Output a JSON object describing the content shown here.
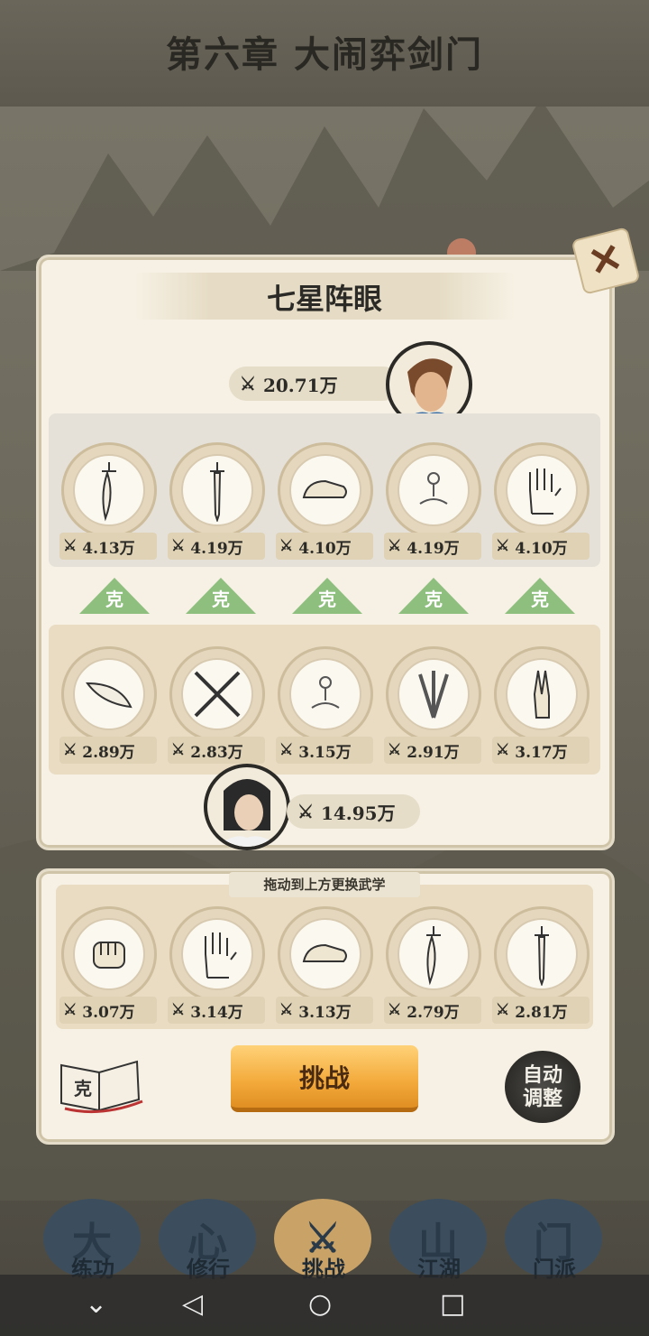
{
  "chapter_title": "第六章 大闹弈剑门",
  "formation": {
    "title": "七星阵眼",
    "enemy_power": "20.71万",
    "player_power": "14.95万",
    "enemy_slots": [
      {
        "icon": "sabre-icon",
        "value": "4.13万"
      },
      {
        "icon": "sword-icon",
        "value": "4.19万"
      },
      {
        "icon": "shoe-icon",
        "value": "4.10万"
      },
      {
        "icon": "meditation-icon",
        "value": "4.19万"
      },
      {
        "icon": "palm-icon",
        "value": "4.10万"
      }
    ],
    "counter_label": "克",
    "player_slots": [
      {
        "icon": "feather-icon",
        "value": "2.89万"
      },
      {
        "icon": "crossed-spears-icon",
        "value": "2.83万"
      },
      {
        "icon": "meditation-icon",
        "value": "3.15万"
      },
      {
        "icon": "daggers-icon",
        "value": "2.91万"
      },
      {
        "icon": "two-finger-icon",
        "value": "3.17万"
      }
    ]
  },
  "skills": {
    "hint": "拖动到上方更换武学",
    "items": [
      {
        "icon": "fist-icon",
        "value": "3.07万"
      },
      {
        "icon": "palm-icon",
        "value": "3.14万"
      },
      {
        "icon": "shoe-icon",
        "value": "3.13万"
      },
      {
        "icon": "sabre-icon",
        "value": "2.79万"
      },
      {
        "icon": "sword-icon",
        "value": "2.81万"
      }
    ],
    "book_label": "克",
    "challenge_label": "挑战",
    "auto_label_1": "自动",
    "auto_label_2": "调整"
  },
  "nav": [
    {
      "label": "练功",
      "glyph": "大"
    },
    {
      "label": "修行",
      "glyph": "心"
    },
    {
      "label": "挑战",
      "glyph": "⚔"
    },
    {
      "label": "江湖",
      "glyph": "山"
    },
    {
      "label": "门派",
      "glyph": "门"
    }
  ],
  "colors": {
    "accent": "#f3a93a",
    "counter": "#8fbf7f",
    "panel": "#f6f1e4"
  }
}
